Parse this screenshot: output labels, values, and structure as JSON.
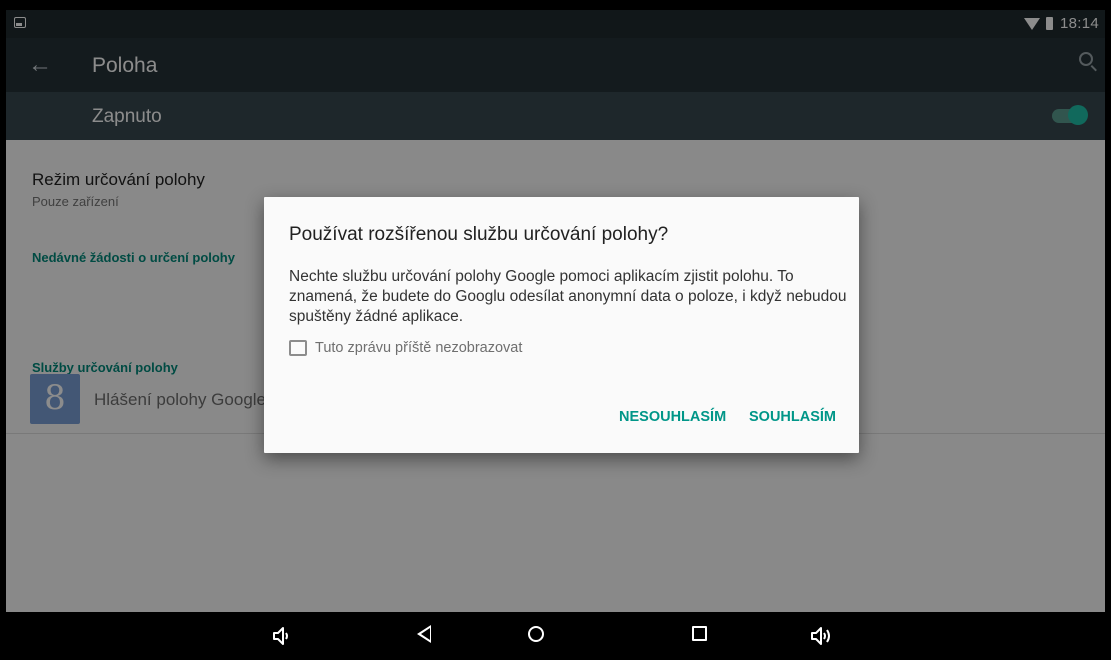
{
  "status_bar": {
    "time": "18:14"
  },
  "app_bar": {
    "title": "Poloha"
  },
  "master_switch": {
    "label": "Zapnuto",
    "state": "on"
  },
  "settings": {
    "mode_title": "Režim určování polohy",
    "mode_value": "Pouze zařízení",
    "recent_requests_header": "Nedávné žádosti o určení polohy",
    "services_header": "Služby určování polohy",
    "google_app_label": "Hlášení polohy Google",
    "google_app_glyph": "8"
  },
  "dialog": {
    "title": "Používat rozšířenou službu určování polohy?",
    "body": "Nechte službu určování polohy Google pomoci aplikacím zjistit polohu. To znamená, že budete do Googlu odesílat anonymní data o poloze, i když nebudou spuštěny žádné aplikace.",
    "checkbox_label": "Tuto zprávu příště nezobrazovat",
    "checkbox_checked": false,
    "decline_label": "NESOUHLASÍM",
    "accept_label": "SOUHLASÍM"
  },
  "colors": {
    "accent": "#009688",
    "app_bar": "#263238",
    "switch_bar": "#37474f"
  }
}
